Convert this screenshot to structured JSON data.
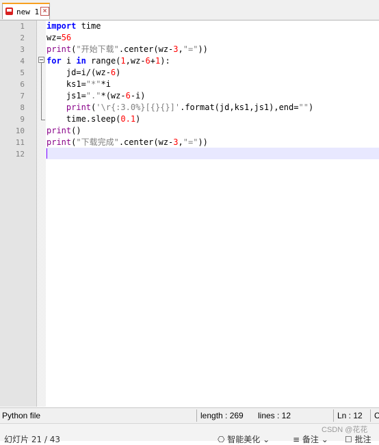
{
  "tab": {
    "label": "new 1"
  },
  "editor": {
    "lines": [
      {
        "n": "1"
      },
      {
        "n": "2"
      },
      {
        "n": "3"
      },
      {
        "n": "4"
      },
      {
        "n": "5"
      },
      {
        "n": "6"
      },
      {
        "n": "7"
      },
      {
        "n": "8"
      },
      {
        "n": "9"
      },
      {
        "n": "10"
      },
      {
        "n": "11"
      },
      {
        "n": "12"
      }
    ],
    "code": {
      "l1": {
        "kw": "import",
        "rest": " time"
      },
      "l2": {
        "a": "wz=",
        "num": "56"
      },
      "l3": {
        "fn": "print",
        "a": "(",
        "str": "\"开始下载\"",
        "b": ".center(wz-",
        "num": "3",
        "c": ",",
        "str2": "\"=\"",
        "d": "))"
      },
      "l4": {
        "kw": "for",
        "a": " i ",
        "kw2": "in",
        "b": " range(",
        "num": "1",
        "c": ",wz-",
        "num2": "6",
        "d": "+",
        "num3": "1",
        "e": "):"
      },
      "l5": {
        "a": "    jd=i/(wz-",
        "num": "6",
        "b": ")"
      },
      "l6": {
        "a": "    ks1=",
        "str": "\"*\"",
        "b": "*i"
      },
      "l7": {
        "a": "    js1=",
        "str": "\".\"",
        "b": "*(wz-",
        "num": "6",
        "c": "-i)"
      },
      "l8": {
        "ind": "    ",
        "fn": "print",
        "a": "(",
        "str": "'\\r{:3.0%}[{}{}]'",
        "b": ".format(jd,ks1,js1),end=",
        "str2": "\"\"",
        "c": ")"
      },
      "l9": {
        "a": "    time.sleep(",
        "num": "0.1",
        "b": ")"
      },
      "l10": {
        "fn": "print",
        "a": "()"
      },
      "l11": {
        "fn": "print",
        "a": "(",
        "str": "\"下载完成\"",
        "b": ".center(wz-",
        "num": "3",
        "c": ",",
        "str2": "\"=\"",
        "d": "))"
      }
    }
  },
  "status": {
    "file_type": "Python file",
    "length": "length : 269",
    "lines": "lines : 12",
    "ln": "Ln : 12",
    "col": "C"
  },
  "bottom": {
    "slide": "幻灯片 21 / 43",
    "beautify": "智能美化 ⌄",
    "notes": "备注 ⌄",
    "comments": "批注",
    "watermark": "CSDN @花花"
  },
  "colors": {
    "keyword": "#0000ff",
    "builtin": "#880088",
    "number": "#ff0000",
    "string": "#808080",
    "current_line": "#e8e8ff"
  }
}
